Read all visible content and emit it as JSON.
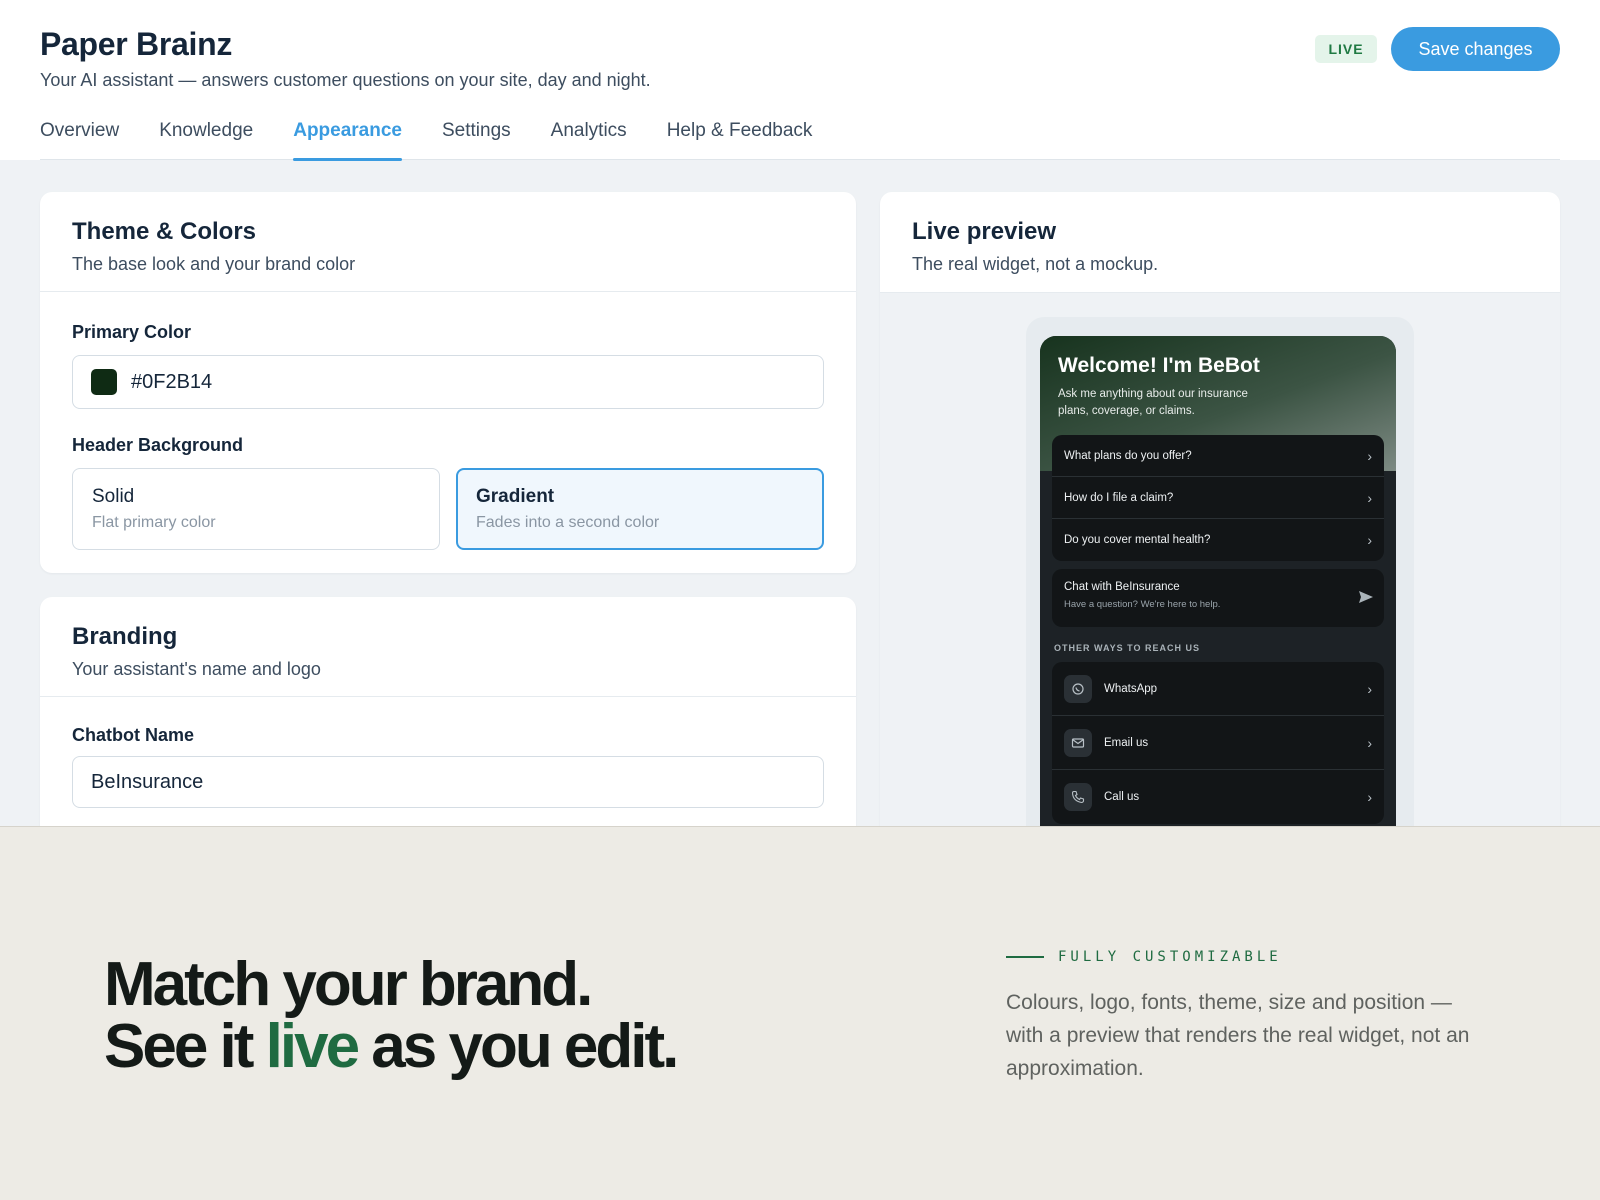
{
  "header": {
    "title": "Paper Brainz",
    "subtitle": "Your AI assistant — answers customer questions on your site, day and night.",
    "status_badge": "LIVE",
    "save_label": "Save changes"
  },
  "tabs": [
    {
      "label": "Overview",
      "active": false
    },
    {
      "label": "Knowledge",
      "active": false
    },
    {
      "label": "Appearance",
      "active": true
    },
    {
      "label": "Settings",
      "active": false
    },
    {
      "label": "Analytics",
      "active": false
    },
    {
      "label": "Help & Feedback",
      "active": false
    }
  ],
  "theme": {
    "title": "Theme & Colors",
    "subtitle": "The base look and your brand color",
    "primary_color_label": "Primary Color",
    "primary_color_value": "#0F2B14",
    "header_bg_label": "Header Background",
    "options": [
      {
        "title": "Solid",
        "subtitle": "Flat primary color",
        "selected": false
      },
      {
        "title": "Gradient",
        "subtitle": "Fades into a second color",
        "selected": true
      }
    ]
  },
  "branding": {
    "title": "Branding",
    "subtitle": "Your assistant's name and logo",
    "name_label": "Chatbot Name",
    "name_value": "BeInsurance"
  },
  "preview": {
    "title": "Live preview",
    "subtitle": "The real widget, not a mockup.",
    "widget": {
      "title": "Welcome! I'm BeBot",
      "subtitle": "Ask me anything about our insurance plans, coverage, or claims.",
      "questions": [
        "What plans do you offer?",
        "How do I file a claim?",
        "Do you cover mental health?"
      ],
      "chat_title": "Chat with BeInsurance",
      "chat_subtitle": "Have a question? We're here to help.",
      "other_ways_label": "OTHER WAYS TO REACH US",
      "contacts": [
        {
          "label": "WhatsApp",
          "icon": "whatsapp-icon"
        },
        {
          "label": "Email us",
          "icon": "mail-icon"
        },
        {
          "label": "Call us",
          "icon": "phone-icon"
        }
      ]
    }
  },
  "marketing": {
    "line1": "Match your brand.",
    "line2_pre": "See it ",
    "line2_highlight": "live",
    "line2_post": " as you edit.",
    "kicker": "FULLY CUSTOMIZABLE",
    "description": "Colours, logo, fonts, theme, size and position — with a preview that renders the real widget, not an approximation."
  },
  "colors": {
    "accent": "#3a9be0",
    "brand_green": "#1f6b41",
    "primary_swatch": "#0f2b14",
    "live_badge_bg": "#e4f4ea"
  }
}
